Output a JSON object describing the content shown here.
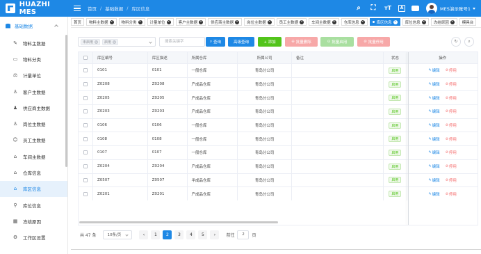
{
  "app": {
    "logo_text": "HUAZHI MES",
    "user_name": "MES演示账号1"
  },
  "breadcrumb": [
    "首页",
    "基础数据",
    "库区信息"
  ],
  "sidebar": {
    "group_label": "基础数据",
    "items": [
      {
        "label": "物料主数据",
        "icon": "broom-icon",
        "glyph": "✎"
      },
      {
        "label": "物料分类",
        "icon": "folder-icon",
        "glyph": "▭"
      },
      {
        "label": "计量单位",
        "icon": "scale-icon",
        "glyph": "⚖"
      },
      {
        "label": "客户主数据",
        "icon": "user-icon",
        "glyph": "♙"
      },
      {
        "label": "供应商主数据",
        "icon": "users-icon",
        "glyph": "♟"
      },
      {
        "label": "岗位主数据",
        "icon": "person-icon",
        "glyph": "♙"
      },
      {
        "label": "员工主数据",
        "icon": "id-card-icon",
        "glyph": "☺"
      },
      {
        "label": "车间主数据",
        "icon": "factory-icon",
        "glyph": "⌂"
      },
      {
        "label": "仓库信息",
        "icon": "warehouse-icon",
        "glyph": "⌂"
      },
      {
        "label": "库区信息",
        "icon": "house-icon",
        "glyph": "⌂",
        "active": true
      },
      {
        "label": "库位信息",
        "icon": "bike-icon",
        "glyph": "⚲"
      },
      {
        "label": "冻结原因",
        "icon": "grid-icon",
        "glyph": "▦"
      },
      {
        "label": "工作区设置",
        "icon": "workspace-icon",
        "glyph": "⚙"
      }
    ]
  },
  "tabs": [
    {
      "label": "首页",
      "closable": false
    },
    {
      "label": "物料主数据",
      "closable": true
    },
    {
      "label": "物料分类",
      "closable": true
    },
    {
      "label": "计量单位",
      "closable": true
    },
    {
      "label": "客户主数据",
      "closable": true
    },
    {
      "label": "供应商主数据",
      "closable": true
    },
    {
      "label": "岗位主数据",
      "closable": true
    },
    {
      "label": "员工主数据",
      "closable": true
    },
    {
      "label": "车间主数据",
      "closable": true
    },
    {
      "label": "仓库信息",
      "closable": true
    },
    {
      "label": "库区信息",
      "closable": true,
      "active": true
    },
    {
      "label": "库位信息",
      "closable": true
    },
    {
      "label": "冻结原因",
      "closable": true
    },
    {
      "label": "模具台",
      "closable": false
    }
  ],
  "toolbar": {
    "status_chips": [
      "未启用",
      "启用"
    ],
    "search_placeholder": "搜索关键字",
    "query_label": "查询",
    "advanced_label": "高级查询",
    "add_label": "+ 添加",
    "batch_delete_label": "批量删除",
    "batch_enable_label": "批量启用",
    "batch_disable_label": "批量停用"
  },
  "table": {
    "headers": [
      "库区编号",
      "库区描述",
      "所属仓库",
      "所属公司",
      "备注",
      "状态",
      "操作"
    ],
    "rows": [
      [
        "0101",
        "0101",
        "一般仓库",
        "青岛分公司",
        "",
        "启用"
      ],
      [
        "Z0208",
        "Z0208",
        "产成品仓库",
        "青岛分公司",
        "",
        "启用"
      ],
      [
        "Z0205",
        "Z0205",
        "产成品仓库",
        "青岛分公司",
        "",
        "启用"
      ],
      [
        "Z0203",
        "Z0203",
        "产成品仓库",
        "青岛分公司",
        "",
        "启用"
      ],
      [
        "0106",
        "0106",
        "一般仓库",
        "青岛分公司",
        "",
        "启用"
      ],
      [
        "0108",
        "0108",
        "一般仓库",
        "青岛分公司",
        "",
        "启用"
      ],
      [
        "0107",
        "0107",
        "一般仓库",
        "青岛分公司",
        "",
        "启用"
      ],
      [
        "Z0204",
        "Z0204",
        "产成品仓库",
        "青岛分公司",
        "",
        "启用"
      ],
      [
        "Z0507",
        "Z0507",
        "半成品仓库",
        "青岛分公司",
        "",
        "启用"
      ],
      [
        "Z0201",
        "Z0201",
        "产成品仓库",
        "青岛分公司",
        "",
        "启用"
      ]
    ],
    "edit_label": "编辑",
    "disable_label": "停用"
  },
  "pagination": {
    "total_text": "共 47 条",
    "page_size": "10条/页",
    "pages": [
      "1",
      "2",
      "3",
      "4",
      "5"
    ],
    "current_page": "2",
    "goto_label": "前往",
    "goto_value": "2",
    "page_unit": "页"
  },
  "colors": {
    "primary": "#1e88e5",
    "success": "#52c41a",
    "danger": "#f56c6c"
  }
}
